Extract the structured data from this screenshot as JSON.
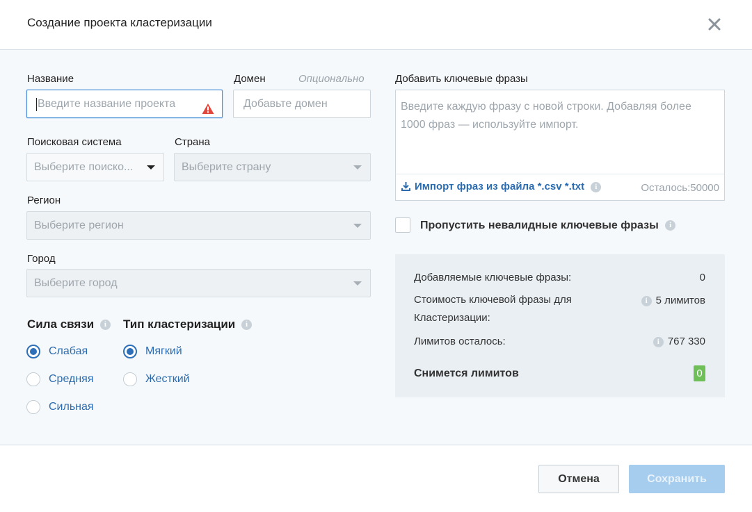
{
  "dialog": {
    "title": "Создание проекта кластеризации"
  },
  "form": {
    "name_label": "Название",
    "name_placeholder": "Введите название проекта",
    "domain_label": "Домен",
    "domain_hint": "Опционально",
    "domain_placeholder": "Добавьте домен",
    "search_engine_label": "Поисковая система",
    "search_engine_value": "Выберите поиско...",
    "country_label": "Страна",
    "country_value": "Выберите страну",
    "region_label": "Регион",
    "region_value": "Выберите регион",
    "city_label": "Город",
    "city_value": "Выберите город",
    "strength_label": "Сила связи",
    "strength_options": [
      "Слабая",
      "Средняя",
      "Сильная"
    ],
    "strength_selected": "Слабая",
    "type_label": "Тип кластеризации",
    "type_options": [
      "Мягкий",
      "Жесткий"
    ],
    "type_selected": "Мягкий"
  },
  "keywords": {
    "label": "Добавить ключевые фразы",
    "placeholder": "Введите каждую фразу с новой строки. Добавляя более 1000 фраз — используйте импорт.",
    "import_label": "Импорт фраз из файла *.csv *.txt",
    "remaining": "Осталось:50000",
    "skip_invalid_label": "Пропустить невалидные ключевые фразы",
    "skip_invalid_checked": false
  },
  "summary": {
    "added_label": "Добавляемые ключевые фразы:",
    "added_value": "0",
    "cost_label": "Стоимость ключевой фразы для Кластеризации:",
    "cost_value": "5 лимитов",
    "limits_left_label": "Лимитов осталось:",
    "limits_left_value": "767 330",
    "charged_label": "Снимется лимитов",
    "charged_value": "0",
    "charged_color": "#6fbf59"
  },
  "footer": {
    "cancel_label": "Отмена",
    "save_label": "Сохранить"
  },
  "icons": {
    "close": "close-icon",
    "warning": "warning-icon",
    "info": "info-icon",
    "download": "download-icon",
    "dropdown": "chevron-down-icon"
  },
  "colors": {
    "accent": "#2b6cb0",
    "focus_border": "#4a90d9",
    "warning": "#e0483e",
    "save_disabled": "#a7cdee"
  }
}
